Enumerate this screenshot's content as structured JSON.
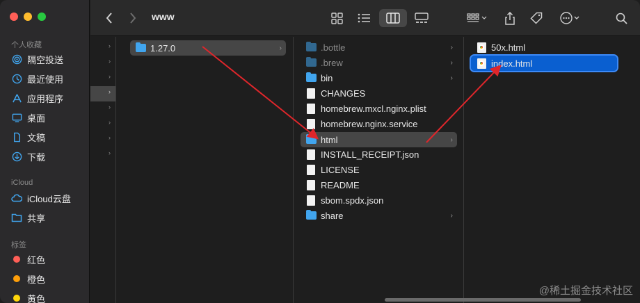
{
  "toolbar": {
    "title": "www",
    "back_icon": "chevron-left-icon",
    "forward_icon": "chevron-right-icon",
    "view_modes": [
      "icon-view-icon",
      "list-view-icon",
      "column-view-icon",
      "gallery-view-icon"
    ],
    "active_view": "column-view-icon",
    "group_icon": "group-by-icon",
    "share_icon": "share-icon",
    "tag_icon": "tag-icon",
    "more_icon": "more-icon",
    "search_icon": "search-icon"
  },
  "sidebar": {
    "favorites_header": "个人收藏",
    "favorites": [
      {
        "label": "隔空投送",
        "icon": "airdrop-icon"
      },
      {
        "label": "最近使用",
        "icon": "clock-icon"
      },
      {
        "label": "应用程序",
        "icon": "applications-icon"
      },
      {
        "label": "桌面",
        "icon": "desktop-icon"
      },
      {
        "label": "文稿",
        "icon": "document-icon"
      },
      {
        "label": "下载",
        "icon": "download-icon"
      }
    ],
    "icloud_header": "iCloud",
    "icloud": [
      {
        "label": "iCloud云盘",
        "icon": "cloud-icon"
      },
      {
        "label": "共享",
        "icon": "shared-folder-icon"
      }
    ],
    "tags_header": "标签",
    "tags": [
      {
        "label": "红色",
        "color": "#ff5f57"
      },
      {
        "label": "橙色",
        "color": "#fe9f0a"
      },
      {
        "label": "黄色",
        "color": "#ffd60a"
      }
    ]
  },
  "column1": {
    "items": [
      {
        "label": "1.27.0",
        "selected": true
      }
    ]
  },
  "column2": {
    "items": [
      {
        "label": ".bottle",
        "type": "folder",
        "dim": true,
        "has_children": true
      },
      {
        "label": ".brew",
        "type": "folder",
        "dim": true,
        "has_children": true
      },
      {
        "label": "bin",
        "type": "folder",
        "has_children": true
      },
      {
        "label": "CHANGES",
        "type": "file"
      },
      {
        "label": "homebrew.mxcl.nginx.plist",
        "type": "file"
      },
      {
        "label": "homebrew.nginx.service",
        "type": "file"
      },
      {
        "label": "html",
        "type": "folder",
        "selected": true,
        "has_children": true
      },
      {
        "label": "INSTALL_RECEIPT.json",
        "type": "file"
      },
      {
        "label": "LICENSE",
        "type": "file"
      },
      {
        "label": "README",
        "type": "file"
      },
      {
        "label": "sbom.spdx.json",
        "type": "file"
      },
      {
        "label": "share",
        "type": "folder",
        "has_children": true
      }
    ]
  },
  "column3": {
    "items": [
      {
        "label": "50x.html",
        "type": "html"
      },
      {
        "label": "index.html",
        "type": "html",
        "selected": true
      }
    ]
  },
  "watermark": "@稀土掘金技术社区",
  "colors": {
    "selection_blue": "#0a5fd0",
    "annotation_arrow": "#e0262b"
  }
}
